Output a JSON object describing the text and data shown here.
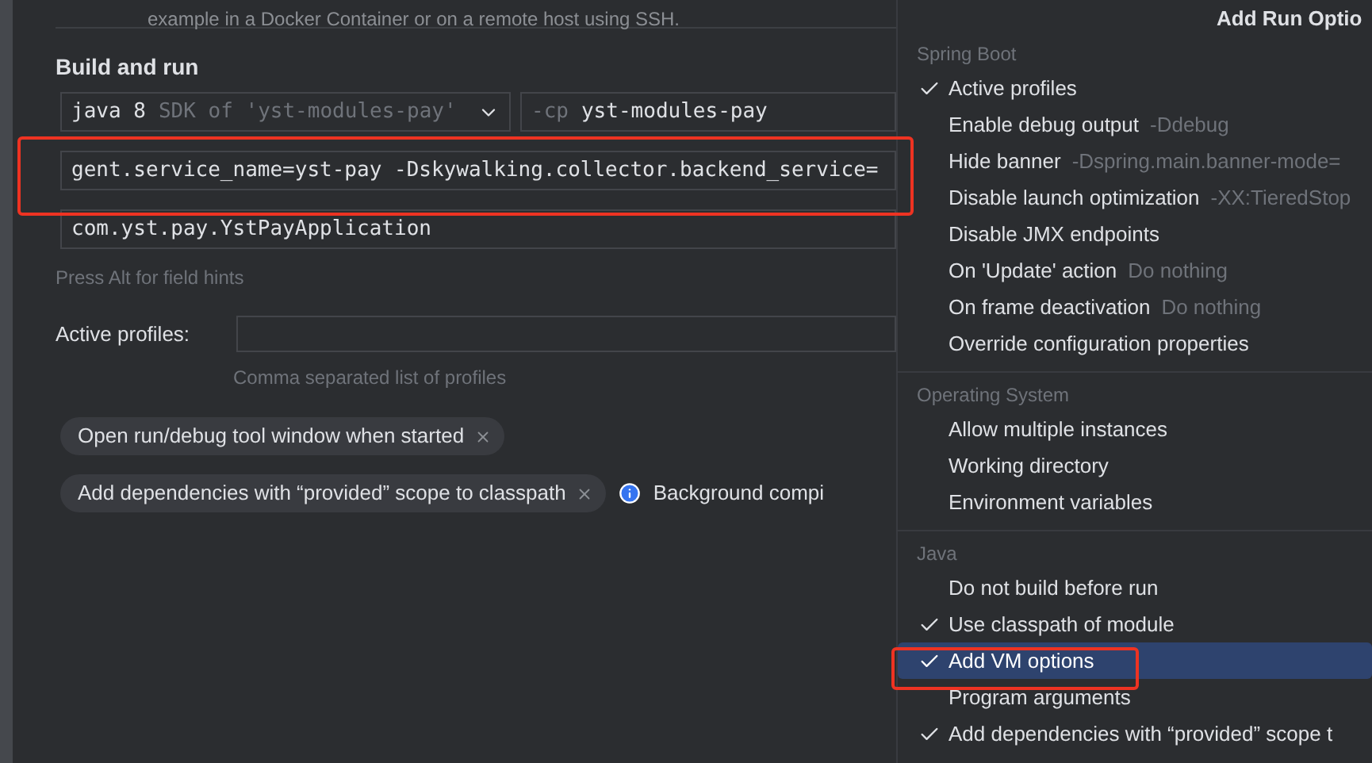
{
  "top_note": "example in a Docker Container or on a remote host using SSH.",
  "section_title": "Build and run",
  "jre": {
    "value": "java 8",
    "hint": "SDK of 'yst-modules-pay'"
  },
  "classpath": {
    "prefix": "-cp",
    "value": "yst-modules-pay"
  },
  "vm_options": {
    "value": "gent.service_name=yst-pay -Dskywalking.collector.backend_service="
  },
  "main_class": {
    "value": "com.yst.pay.YstPayApplication"
  },
  "field_hints": "Press Alt for field hints",
  "active_profiles": {
    "label": "Active profiles:",
    "hint": "Comma separated list of profiles"
  },
  "chips": [
    {
      "label": "Open run/debug tool window when started"
    },
    {
      "label": "Add dependencies with “provided” scope to classpath"
    }
  ],
  "info": {
    "text": "Background compi"
  },
  "menu": {
    "title": "Add Run Optio",
    "groups": [
      {
        "name": "Spring Boot",
        "items": [
          {
            "label": "Active profiles",
            "checked": true,
            "selected": false
          },
          {
            "label": "Enable debug output",
            "hint": "-Ddebug",
            "checked": false,
            "selected": false
          },
          {
            "label": "Hide banner",
            "hint": "-Dspring.main.banner-mode=",
            "checked": false,
            "selected": false
          },
          {
            "label": "Disable launch optimization",
            "hint": "-XX:TieredStop",
            "checked": false,
            "selected": false
          },
          {
            "label": "Disable JMX endpoints",
            "checked": false,
            "selected": false
          },
          {
            "label": "On 'Update' action",
            "hint": "Do nothing",
            "checked": false,
            "selected": false
          },
          {
            "label": "On frame deactivation",
            "hint": "Do nothing",
            "checked": false,
            "selected": false
          },
          {
            "label": "Override configuration properties",
            "checked": false,
            "selected": false
          }
        ]
      },
      {
        "name": "Operating System",
        "items": [
          {
            "label": "Allow multiple instances",
            "checked": false,
            "selected": false
          },
          {
            "label": "Working directory",
            "checked": false,
            "selected": false
          },
          {
            "label": "Environment variables",
            "checked": false,
            "selected": false
          }
        ]
      },
      {
        "name": "Java",
        "items": [
          {
            "label": "Do not build before run",
            "checked": false,
            "selected": false
          },
          {
            "label": "Use classpath of module",
            "checked": true,
            "selected": false
          },
          {
            "label": "Add VM options",
            "checked": true,
            "selected": true
          },
          {
            "label": "Program arguments",
            "checked": false,
            "selected": false
          },
          {
            "label": "Add dependencies with “provided” scope t",
            "checked": true,
            "selected": false
          }
        ]
      }
    ]
  }
}
